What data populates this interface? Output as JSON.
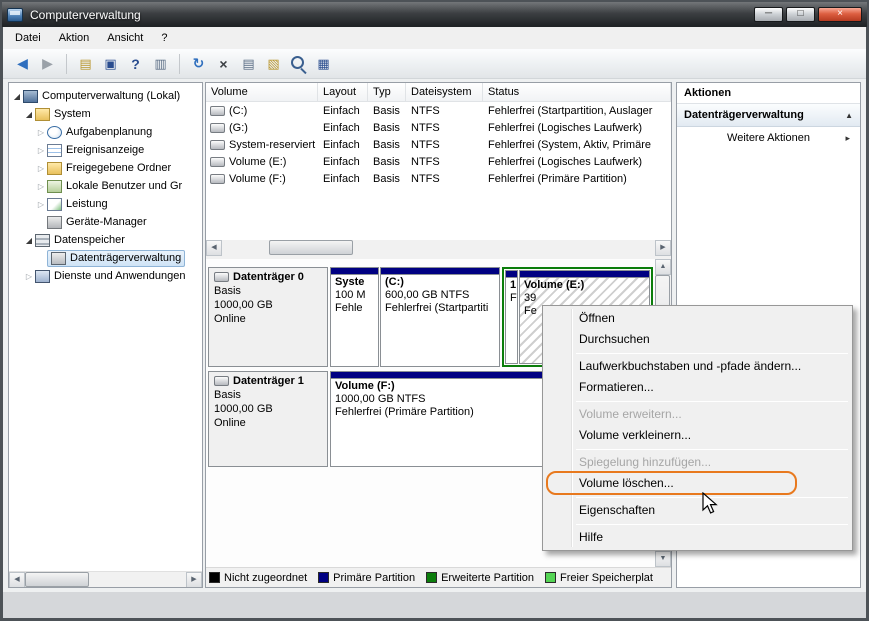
{
  "window": {
    "title": "Computerverwaltung",
    "minimize_glyph": "─",
    "maximize_glyph": "□",
    "close_glyph": "×"
  },
  "menubar": {
    "items": [
      "Datei",
      "Aktion",
      "Ansicht",
      "?"
    ]
  },
  "toolbar": {
    "icons": [
      {
        "name": "back",
        "glyph": "◀"
      },
      {
        "name": "forward",
        "glyph": "▶"
      },
      {
        "name": "export-list",
        "glyph": "▤"
      },
      {
        "name": "show-console-tree",
        "glyph": "▣"
      },
      {
        "name": "help",
        "glyph": "?"
      },
      {
        "name": "console-window",
        "glyph": "▥"
      },
      {
        "name": "refresh",
        "glyph": "↻"
      },
      {
        "name": "delete",
        "glyph": "×"
      },
      {
        "name": "properties",
        "glyph": "▤"
      },
      {
        "name": "open-folder",
        "glyph": "▧"
      },
      {
        "name": "search",
        "glyph": ""
      },
      {
        "name": "script",
        "glyph": "▦"
      }
    ]
  },
  "scrollbars": {
    "left": "◀",
    "right": "▶",
    "up": "▲",
    "down": "▼"
  },
  "tree": {
    "items": [
      {
        "label": "Computerverwaltung (Lokal)",
        "expander": "◢"
      },
      {
        "label": "System",
        "expander": "◢"
      },
      {
        "label": "Aufgabenplanung",
        "expander": "▷"
      },
      {
        "label": "Ereignisanzeige",
        "expander": "▷"
      },
      {
        "label": "Freigegebene Ordner",
        "expander": "▷"
      },
      {
        "label": "Lokale Benutzer und Gr",
        "expander": "▷"
      },
      {
        "label": "Leistung",
        "expander": "▷"
      },
      {
        "label": "Geräte-Manager",
        "expander": ""
      },
      {
        "label": "Datenspeicher",
        "expander": "◢"
      },
      {
        "label": "Datenträgerverwaltung",
        "expander": "",
        "selected": true
      },
      {
        "label": "Dienste und Anwendungen",
        "expander": "▷"
      }
    ]
  },
  "volume_list": {
    "columns": [
      "Volume",
      "Layout",
      "Typ",
      "Dateisystem",
      "Status"
    ],
    "rows": [
      {
        "volume": "(C:)",
        "layout": "Einfach",
        "typ": "Basis",
        "fs": "NTFS",
        "status": "Fehlerfrei (Startpartition, Auslager"
      },
      {
        "volume": "(G:)",
        "layout": "Einfach",
        "typ": "Basis",
        "fs": "NTFS",
        "status": "Fehlerfrei (Logisches Laufwerk)"
      },
      {
        "volume": "System-reserviert",
        "layout": "Einfach",
        "typ": "Basis",
        "fs": "NTFS",
        "status": "Fehlerfrei (System, Aktiv, Primäre"
      },
      {
        "volume": "Volume (E:)",
        "layout": "Einfach",
        "typ": "Basis",
        "fs": "NTFS",
        "status": "Fehlerfrei (Logisches Laufwerk)"
      },
      {
        "volume": "Volume (F:)",
        "layout": "Einfach",
        "typ": "Basis",
        "fs": "NTFS",
        "status": "Fehlerfrei (Primäre Partition)"
      }
    ]
  },
  "disk_view": {
    "disks": [
      {
        "name": "Datenträger 0",
        "type": "Basis",
        "size": "1000,00 GB",
        "state": "Online",
        "partitions": [
          {
            "name": "Syste",
            "info": "100 M",
            "status": "Fehle"
          },
          {
            "name": "(C:)",
            "info": "600,00 GB NTFS",
            "status": "Fehlerfrei (Startpartiti"
          },
          {
            "name": "1",
            "info": "F",
            "status": ""
          },
          {
            "name": "Volume (E:)",
            "info": "39",
            "status": "Fe",
            "selected": true
          }
        ]
      },
      {
        "name": "Datenträger 1",
        "type": "Basis",
        "size": "1000,00 GB",
        "state": "Online",
        "partitions": [
          {
            "name": "Volume (F:)",
            "info": "1000,00 GB NTFS",
            "status": "Fehlerfrei (Primäre Partition)"
          }
        ]
      }
    ]
  },
  "context_menu": {
    "items": [
      {
        "label": "Öffnen",
        "enabled": true
      },
      {
        "label": "Durchsuchen",
        "enabled": true
      },
      {
        "label": "Laufwerkbuchstaben und -pfade ändern...",
        "enabled": true
      },
      {
        "label": "Formatieren...",
        "enabled": true
      },
      {
        "label": "Volume erweitern...",
        "enabled": false
      },
      {
        "label": "Volume verkleinern...",
        "enabled": true
      },
      {
        "label": "Spiegelung hinzufügen...",
        "enabled": false
      },
      {
        "label": "Volume löschen...",
        "enabled": true,
        "highlighted": true
      },
      {
        "label": "Eigenschaften",
        "enabled": true
      },
      {
        "label": "Hilfe",
        "enabled": true
      }
    ]
  },
  "actions": {
    "header": "Aktionen",
    "section": "Datenträgerverwaltung",
    "section_chevron": "▲",
    "more": "Weitere Aktionen",
    "more_arrow": "▸"
  },
  "legend": {
    "items": [
      {
        "label": "Nicht zugeordnet",
        "color": "#000000"
      },
      {
        "label": "Primäre Partition",
        "color": "#000082"
      },
      {
        "label": "Erweiterte Partition",
        "color": "#0B7D0B"
      },
      {
        "label": "Freier Speicherplat",
        "color": "#54D454"
      }
    ]
  },
  "colors": {
    "annotation_highlight": "#E8791E",
    "primary_partition_stripe": "#000082",
    "extended_partition_border": "#0B7D0B",
    "free_space": "#54D454",
    "unallocated": "#000000",
    "titlebar_text": "#FFFFFF"
  }
}
